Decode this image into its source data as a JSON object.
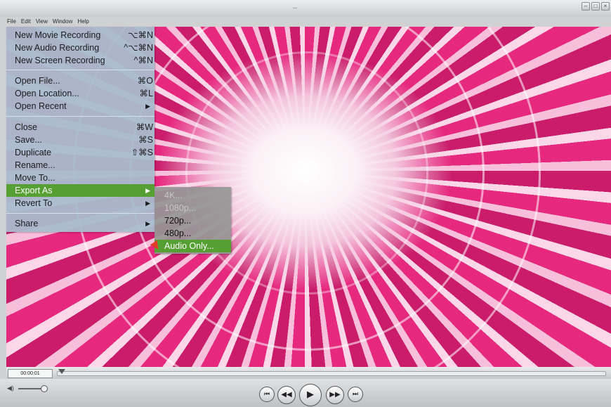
{
  "window": {
    "title": "--",
    "buttons": [
      "minimize",
      "zoom",
      "close"
    ]
  },
  "menubar": {
    "items": [
      "File",
      "Edit",
      "View",
      "Window",
      "Help"
    ]
  },
  "file_menu": {
    "items": [
      {
        "label": "New Movie Recording",
        "shortcut": "⌥⌘N"
      },
      {
        "label": "New Audio Recording",
        "shortcut": "^⌥⌘N"
      },
      {
        "label": "New Screen Recording",
        "shortcut": "^⌘N"
      },
      {
        "label": "Open File...",
        "shortcut": "⌘O"
      },
      {
        "label": "Open Location...",
        "shortcut": "⌘L"
      },
      {
        "label": "Open Recent",
        "shortcut": ""
      },
      {
        "label": "Close",
        "shortcut": "⌘W"
      },
      {
        "label": "Save...",
        "shortcut": "⌘S"
      },
      {
        "label": "Duplicate",
        "shortcut": "⇧⌘S"
      },
      {
        "label": "Rename...",
        "shortcut": ""
      },
      {
        "label": "Move To...",
        "shortcut": ""
      },
      {
        "label": "Export As",
        "shortcut": ""
      },
      {
        "label": "Revert To",
        "shortcut": ""
      },
      {
        "label": "Share",
        "shortcut": ""
      }
    ],
    "highlighted": "Export As"
  },
  "export_submenu": {
    "items": [
      "4K...",
      "1080p...",
      "720p...",
      "480p...",
      "Audio Only..."
    ],
    "disabled": [
      "4K...",
      "1080p..."
    ],
    "highlighted": "Audio Only..."
  },
  "player": {
    "timecode": "00:00:01",
    "controls": [
      "skip-back",
      "rewind",
      "play",
      "fast-forward",
      "skip-forward"
    ]
  },
  "colors": {
    "highlight": "#56a033",
    "menu_bg": "#a8bcce",
    "submenu_bg": "#969696"
  }
}
